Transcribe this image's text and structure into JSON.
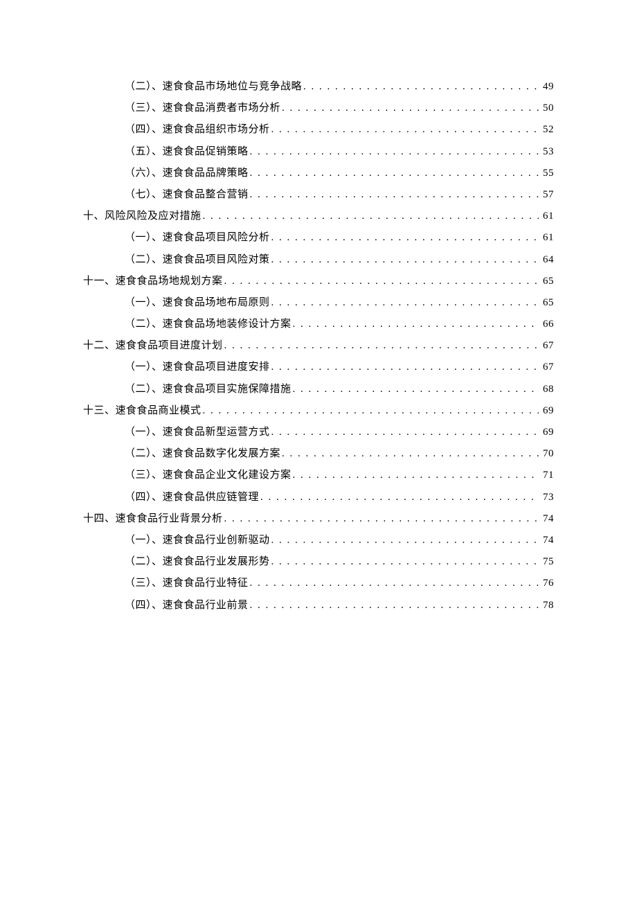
{
  "toc": [
    {
      "level": 2,
      "label": "（二）、速食食品市场地位与竞争战略",
      "page": "49"
    },
    {
      "level": 2,
      "label": "（三）、速食食品消费者市场分析",
      "page": "50"
    },
    {
      "level": 2,
      "label": "（四）、速食食品组织市场分析",
      "page": "52"
    },
    {
      "level": 2,
      "label": "（五）、速食食品促销策略",
      "page": "53"
    },
    {
      "level": 2,
      "label": "（六）、速食食品品牌策略",
      "page": "55"
    },
    {
      "level": 2,
      "label": "（七）、速食食品整合营销",
      "page": "57"
    },
    {
      "level": 1,
      "label": "十、风险风险及应对措施",
      "page": "61"
    },
    {
      "level": 2,
      "label": "（一）、速食食品项目风险分析",
      "page": "61"
    },
    {
      "level": 2,
      "label": "（二）、速食食品项目风险对策",
      "page": "64"
    },
    {
      "level": 1,
      "label": "十一、速食食品场地规划方案",
      "page": "65"
    },
    {
      "level": 2,
      "label": "（一）、速食食品场地布局原则",
      "page": "65"
    },
    {
      "level": 2,
      "label": "（二）、速食食品场地装修设计方案",
      "page": "66"
    },
    {
      "level": 1,
      "label": "十二、速食食品项目进度计划",
      "page": "67"
    },
    {
      "level": 2,
      "label": "（一）、速食食品项目进度安排",
      "page": "67"
    },
    {
      "level": 2,
      "label": "（二）、速食食品项目实施保障措施",
      "page": "68"
    },
    {
      "level": 1,
      "label": "十三、速食食品商业模式",
      "page": "69"
    },
    {
      "level": 2,
      "label": "（一）、速食食品新型运营方式",
      "page": "69"
    },
    {
      "level": 2,
      "label": "（二）、速食食品数字化发展方案",
      "page": "70"
    },
    {
      "level": 2,
      "label": "（三）、速食食品企业文化建设方案",
      "page": "71"
    },
    {
      "level": 2,
      "label": "（四）、速食食品供应链管理",
      "page": "73"
    },
    {
      "level": 1,
      "label": "十四、速食食品行业背景分析",
      "page": "74"
    },
    {
      "level": 2,
      "label": "（一）、速食食品行业创新驱动",
      "page": "74"
    },
    {
      "level": 2,
      "label": "（二）、速食食品行业发展形势",
      "page": "75"
    },
    {
      "level": 2,
      "label": "（三）、速食食品行业特征",
      "page": "76"
    },
    {
      "level": 2,
      "label": "（四）、速食食品行业前景",
      "page": "78"
    }
  ]
}
